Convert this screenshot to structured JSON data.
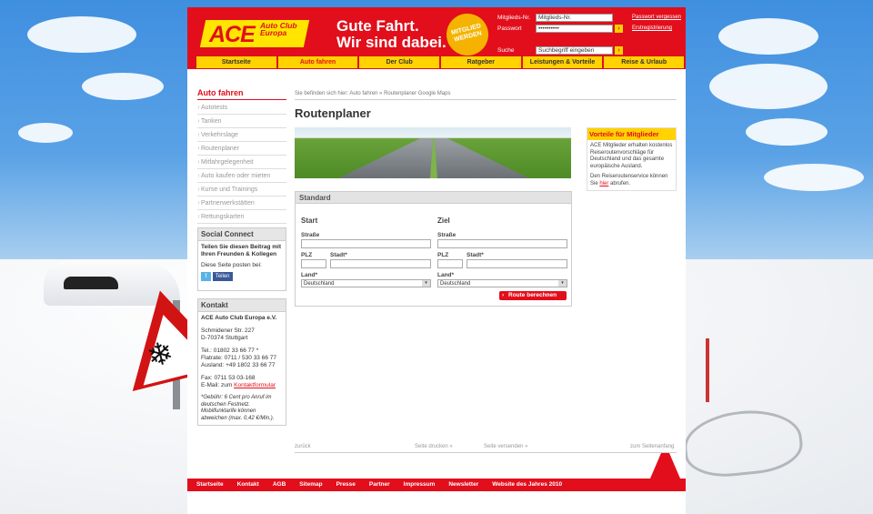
{
  "header": {
    "logo_ace": "ACE",
    "logo_sub": "Auto Club Europa",
    "slogan_line1": "Gute Fahrt.",
    "slogan_line2": "Wir sind dabei.",
    "badge_line1": "MITGLIED",
    "badge_line2": "WERDEN",
    "login": {
      "member_label": "Mitglieds-Nr.",
      "member_value": "Mitglieds-Nr.",
      "password_label": "Passwort",
      "password_value": "••••••••••",
      "forgot_link": "Passwort vergessen",
      "register_link": "Erstregistrierung",
      "search_label": "Suche",
      "search_value": "Suchbegriff eingeben",
      "go": "›"
    }
  },
  "nav": [
    "Startseite",
    "Auto fahren",
    "Der Club",
    "Ratgeber",
    "Leistungen & Vorteile",
    "Reise & Urlaub"
  ],
  "breadcrumb": "Sie befinden sich hier: Auto fahren » Routenplaner Google Maps",
  "page_title": "Routenplaner",
  "sidebar": {
    "title": "Auto fahren",
    "items": [
      "Autotests",
      "Tanken",
      "Verkehrslage",
      "Routenplaner",
      "Mitfahrgelegenheit",
      "Auto kaufen oder mieten",
      "Kurse und Trainings",
      "Partnerwerkstätten",
      "Rettungskarten"
    ]
  },
  "social": {
    "title": "Social Connect",
    "text": "Teilen Sie diesen Beitrag mit Ihren Freunden & Kollegen",
    "post_label": "Diese Seite posten bei:",
    "twitter": "t",
    "share": "Teilen"
  },
  "contact": {
    "title": "Kontakt",
    "org": "ACE Auto Club Europa e.V.",
    "street": "Schmidener Str. 227",
    "city": "D-70374 Stuttgart",
    "tel": "Tel.: 01802 33 66 77 *",
    "flatrate": "Flatrate: 0711 / 530 33 66 77",
    "abroad": "Ausland: +49 1802 33 66 77",
    "fax": "Fax: 0711 53 03-168",
    "email_prefix": "E-Mail: zum ",
    "email_link": "Kontaktformular",
    "note": "*Gebühr: 6 Cent pro Anruf im deutschen Festnetz. Mobilfunktarife können abweichen (max. 0,42 €/Min.)."
  },
  "form": {
    "title": "Standard",
    "start": "Start",
    "ziel": "Ziel",
    "street": "Straße",
    "plz": "PLZ",
    "city": "Stadt*",
    "country": "Land*",
    "country_value": "Deutschland",
    "button": "Route berechnen"
  },
  "benefits": {
    "title": "Vorteile für Mitglieder",
    "text": "ACE Mitglieder erhalten kostenlos Reiseroutenvorschläge für Deutschland und das gesamte europäische Ausland.",
    "text2_prefix": "Den Reiseroutenservice können Sie ",
    "text2_link": "hier",
    "text2_suffix": " abrufen."
  },
  "utility": {
    "back": "zurück",
    "print": "Seite drucken »",
    "send": "Seite versenden »",
    "top": "zum Seitenanfang"
  },
  "footer": [
    "Startseite",
    "Kontakt",
    "AGB",
    "Sitemap",
    "Presse",
    "Partner",
    "Impressum",
    "Newsletter",
    "Website des Jahres 2010"
  ],
  "colors": {
    "brand_red": "#e20e1b",
    "brand_yellow": "#ffd200"
  }
}
